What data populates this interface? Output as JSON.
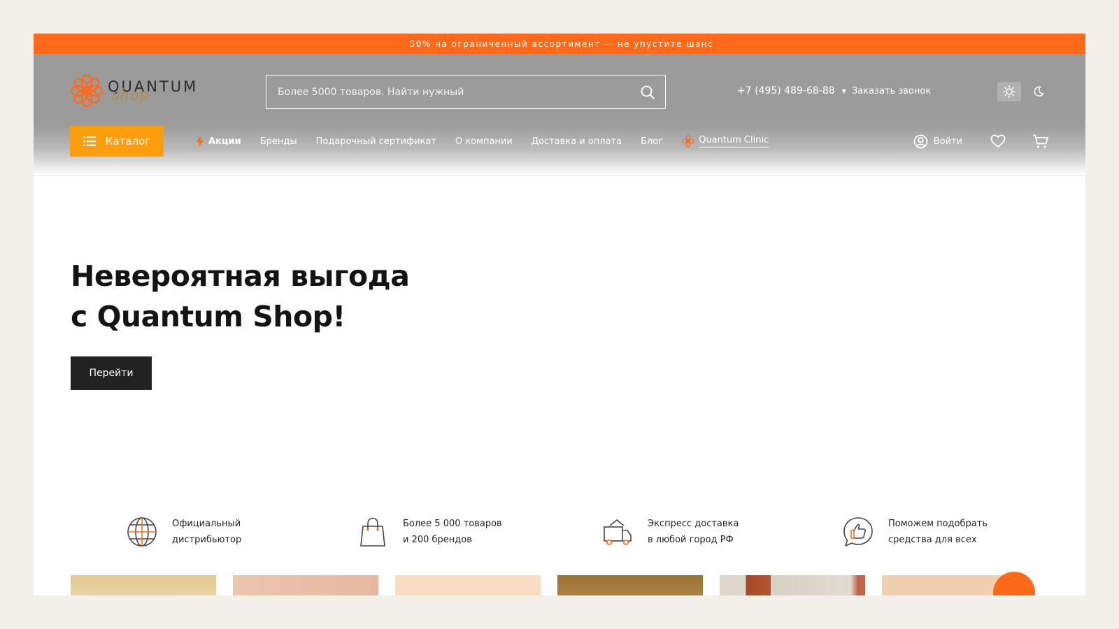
{
  "promo": {
    "text": "-50% на ограниченный ассортимент — не упустите шанс"
  },
  "logo": {
    "word": "QUANTUM",
    "script": "shop"
  },
  "search": {
    "placeholder": "Более 5000 товаров. Найти нужный"
  },
  "contacts": {
    "phone": "+7 (495) 489-68-88",
    "caret": "▼",
    "callback": "Заказать звонок"
  },
  "theme": {
    "light_icon": "sun-icon",
    "dark_icon": "moon-icon",
    "active": "light"
  },
  "nav": {
    "catalog_label": "Каталог",
    "items": [
      {
        "label": "Акции",
        "icon": "lightning-icon"
      },
      {
        "label": "Бренды"
      },
      {
        "label": "Подарочный сертификат"
      },
      {
        "label": "О компании"
      },
      {
        "label": "Доставка и оплата"
      },
      {
        "label": "Блог"
      },
      {
        "label": "Quantum Clinic",
        "icon": "flower-logo-icon"
      }
    ],
    "login_label": "Войти"
  },
  "hero": {
    "title_line1": "Невероятная выгода",
    "title_line2": "с Quantum Shop!",
    "button_label": "Перейти"
  },
  "features": [
    {
      "icon": "globe-icon",
      "line1": "Официальный",
      "line2": "дистрибьютор"
    },
    {
      "icon": "shopping-bag-icon",
      "line1": "Более 5 000 товаров",
      "line2": "и 200 брендов"
    },
    {
      "icon": "delivery-truck-icon",
      "line1": "Экспресс доставка",
      "line2": "в любой город РФ"
    },
    {
      "icon": "thumbs-up-chat-icon",
      "line1": "Поможем подобрать",
      "line2": "средства для всех"
    }
  ],
  "colors": {
    "accent": "#ff6a1a",
    "catalog": "#ff9e0c",
    "header_gray": "#9b9b9b",
    "dark_button": "#222222",
    "card_colors": [
      "#e7cf9a",
      "#e9c0a6",
      "#f8dcc0",
      "#a8813f",
      "#d9d3c8",
      "#f0cfb0"
    ]
  }
}
